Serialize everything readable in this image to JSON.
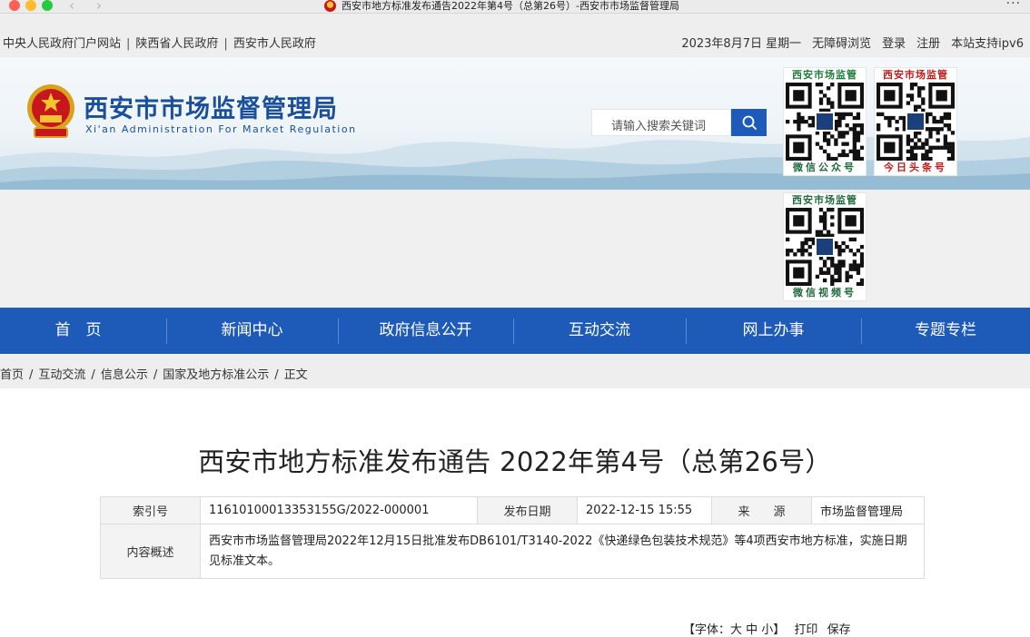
{
  "window": {
    "title": "西安市地方标准发布通告2022年第4号（总第26号）-西安市市场监督管理局",
    "icons": [
      "back-arrow",
      "forward-arrow",
      "favicon-emblem",
      "more-icon"
    ]
  },
  "toplinks": {
    "left": [
      "中央人民政府门户网站",
      "陕西省人民政府",
      "西安市人民政府"
    ],
    "separator": "|",
    "date": "2023年8月7日 星期一",
    "accessibility": "无障碍浏览",
    "login": "登录",
    "register": "注册",
    "ipv6": "本站支持ipv6"
  },
  "header": {
    "site_name": "西安市市场监督管理局",
    "site_name_en": "Xi'an Administration For Market Regulation",
    "search_placeholder": "请输入搜索关键词",
    "qr_codes": [
      {
        "head": "西安市场监管",
        "foot": "微信公众号"
      },
      {
        "head": "西安市场监管",
        "foot": "今日头条号"
      },
      {
        "head": "西安市场监管",
        "foot": "微信视频号"
      }
    ]
  },
  "nav": [
    "首　页",
    "新闻中心",
    "政府信息公开",
    "互动交流",
    "网上办事",
    "专题专栏"
  ],
  "breadcrumb": [
    "首页",
    "互动交流",
    "信息公示",
    "国家及地方标准公示",
    "正文"
  ],
  "article": {
    "title": "西安市地方标准发布通告 2022年第4号（总第26号）",
    "meta": {
      "index_label": "索引号",
      "index_value": "11610100013353155G/2022-000001",
      "date_label": "发布日期",
      "date_value": "2022-12-15 15:55",
      "source_label": "来　　源",
      "source_value": "市场监督管理局",
      "summary_label": "内容概述",
      "summary_value": "西安市市场监督管理局2022年12月15日批准发布DB6101/T3140-2022《快递绿色包装技术规范》等4项西安市地方标准，实施日期见标准文本。"
    },
    "toolbar": {
      "font_text": "【字体：大 中 小】",
      "print": "打印",
      "close": "保存"
    }
  },
  "colors": {
    "nav_bg": "#1e5bb8",
    "brand_blue": "#1a4f9c",
    "qr_green": "#1d7d3a",
    "qr_red": "#c01a1a"
  }
}
